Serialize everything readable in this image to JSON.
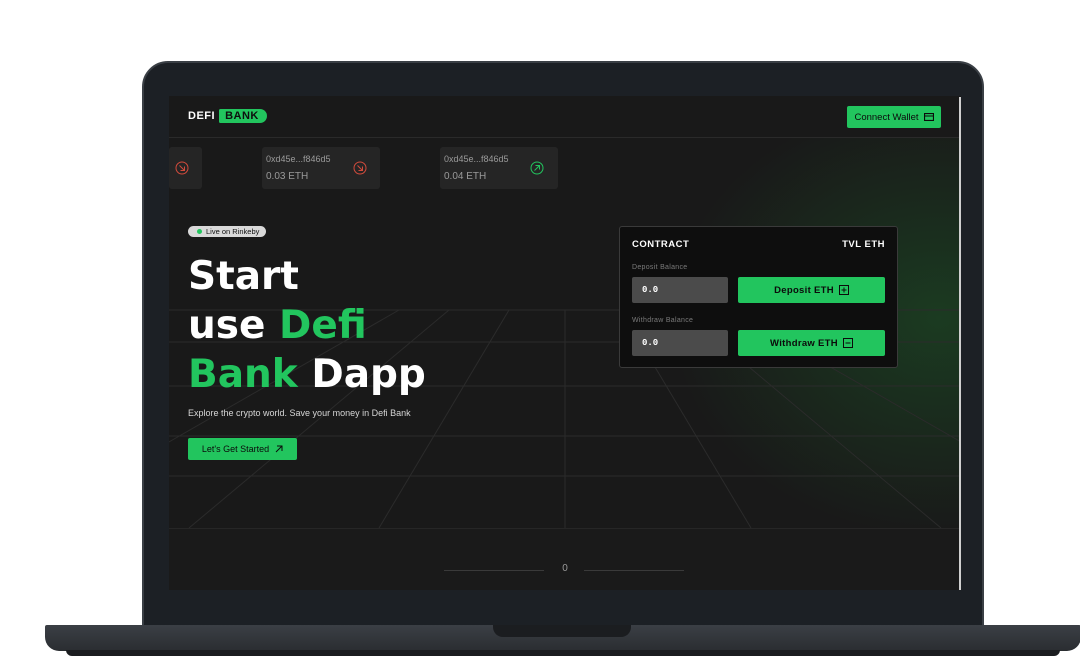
{
  "brand": {
    "name_part1": "DEFI",
    "name_part2": "BANK",
    "accent": "#22c55e"
  },
  "nav": {
    "connect_label": "Connect Wallet",
    "connect_icon": "wallet-icon"
  },
  "transactions": [
    {
      "address": "",
      "amount": "",
      "direction": "out"
    },
    {
      "address": "0xd45e...f846d5",
      "amount": "0.03 ETH",
      "direction": "out"
    },
    {
      "address": "0xd45e...f846d5",
      "amount": "0.04 ETH",
      "direction": "in"
    }
  ],
  "hero": {
    "badge": "Live on Rinkeby",
    "title_line1": "Start",
    "title_line2_a": "use ",
    "title_line2_b": "Defi",
    "title_line3_a": "Bank",
    "title_line3_b": " Dapp",
    "subtitle": "Explore the crypto world. Save your money in Defi Bank",
    "cta_label": "Let's Get Started"
  },
  "contract": {
    "title": "CONTRACT",
    "tvl": "TVL ETH",
    "deposit_label": "Deposit Balance",
    "deposit_value": "0.0",
    "deposit_button": "Deposit ETH",
    "withdraw_label": "Withdraw Balance",
    "withdraw_value": "0.0",
    "withdraw_button": "Withdraw ETH"
  },
  "footer": {
    "value": "0"
  }
}
